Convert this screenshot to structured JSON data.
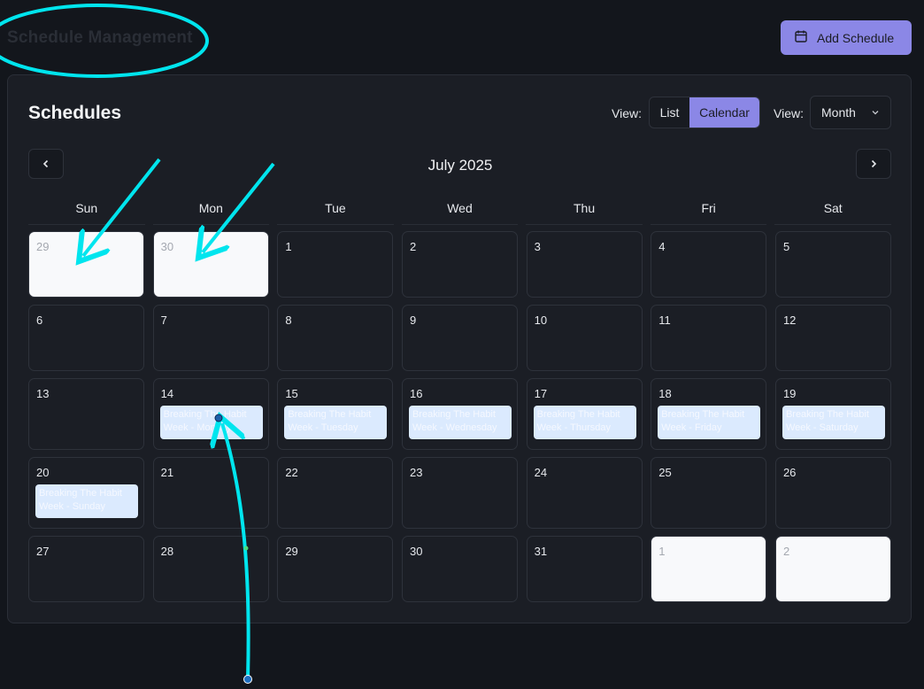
{
  "page_title": "Schedule Management",
  "add_button": {
    "label": "Add Schedule",
    "icon": "calendar-icon"
  },
  "card": {
    "title": "Schedules",
    "view_label_1": "View:",
    "view_label_2": "View:",
    "toggle": {
      "list": "List",
      "calendar": "Calendar",
      "selected": "Calendar"
    },
    "range_select": {
      "value": "Month"
    },
    "month_title": "July 2025"
  },
  "weekdays": [
    "Sun",
    "Mon",
    "Tue",
    "Wed",
    "Thu",
    "Fri",
    "Sat"
  ],
  "weeks": [
    [
      {
        "day": "29",
        "other": true
      },
      {
        "day": "30",
        "other": true
      },
      {
        "day": "1"
      },
      {
        "day": "2"
      },
      {
        "day": "3"
      },
      {
        "day": "4"
      },
      {
        "day": "5"
      }
    ],
    [
      {
        "day": "6"
      },
      {
        "day": "7"
      },
      {
        "day": "8"
      },
      {
        "day": "9"
      },
      {
        "day": "10"
      },
      {
        "day": "11"
      },
      {
        "day": "12"
      }
    ],
    [
      {
        "day": "13"
      },
      {
        "day": "14",
        "event": "Breaking The Habit Week - Monday"
      },
      {
        "day": "15",
        "event": "Breaking The Habit Week - Tuesday"
      },
      {
        "day": "16",
        "event": "Breaking The Habit Week - Wednesday"
      },
      {
        "day": "17",
        "event": "Breaking The Habit Week - Thursday"
      },
      {
        "day": "18",
        "event": "Breaking The Habit Week - Friday"
      },
      {
        "day": "19",
        "event": "Breaking The Habit Week - Saturday"
      }
    ],
    [
      {
        "day": "20",
        "event": "Breaking The Habit Week - Sunday"
      },
      {
        "day": "21"
      },
      {
        "day": "22"
      },
      {
        "day": "23"
      },
      {
        "day": "24"
      },
      {
        "day": "25"
      },
      {
        "day": "26"
      }
    ],
    [
      {
        "day": "27"
      },
      {
        "day": "28"
      },
      {
        "day": "29"
      },
      {
        "day": "30"
      },
      {
        "day": "31"
      },
      {
        "day": "1",
        "other": true
      },
      {
        "day": "2",
        "other": true
      }
    ]
  ],
  "colors": {
    "accent": "#8b87e6",
    "event_bg": "#dbeafe",
    "annotation": "#00e5ee",
    "background": "#13161c"
  }
}
